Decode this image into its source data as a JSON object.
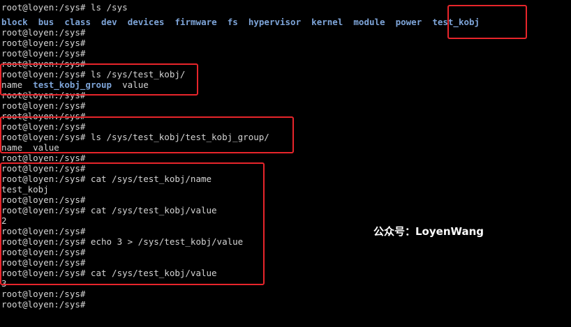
{
  "prompt": "root@loyen:/sys#",
  "lines": [
    "root@loyen:/sys# ls /sys",
    "",
    "root@loyen:/sys#",
    "root@loyen:/sys#",
    "root@loyen:/sys#",
    "root@loyen:/sys#",
    "root@loyen:/sys# ls /sys/test_kobj/",
    "",
    "root@loyen:/sys#",
    "root@loyen:/sys#",
    "root@loyen:/sys#",
    "root@loyen:/sys#",
    "root@loyen:/sys# ls /sys/test_kobj/test_kobj_group/",
    "name  value",
    "root@loyen:/sys#",
    "root@loyen:/sys#",
    "root@loyen:/sys# cat /sys/test_kobj/name",
    "test_kobj",
    "root@loyen:/sys#",
    "root@loyen:/sys# cat /sys/test_kobj/value",
    "2",
    "root@loyen:/sys#",
    "root@loyen:/sys# echo 3 > /sys/test_kobj/value",
    "root@loyen:/sys#",
    "root@loyen:/sys#",
    "root@loyen:/sys# cat /sys/test_kobj/value",
    "3",
    "root@loyen:/sys#",
    "root@loyen:/sys#"
  ],
  "ls_sys_entries": [
    "block",
    "bus",
    "class",
    "dev",
    "devices",
    "firmware",
    "fs",
    "hypervisor",
    "kernel",
    "module",
    "power",
    "test_kobj"
  ],
  "ls_test_kobj_entries": {
    "first": "name",
    "group": "test_kobj_group",
    "last": "value"
  },
  "watermark": "公众号：LoyenWang",
  "colors": {
    "background": "#000000",
    "text": "#d4d4d4",
    "directory": "#7ea5d9",
    "highlight": "#e8252b"
  }
}
